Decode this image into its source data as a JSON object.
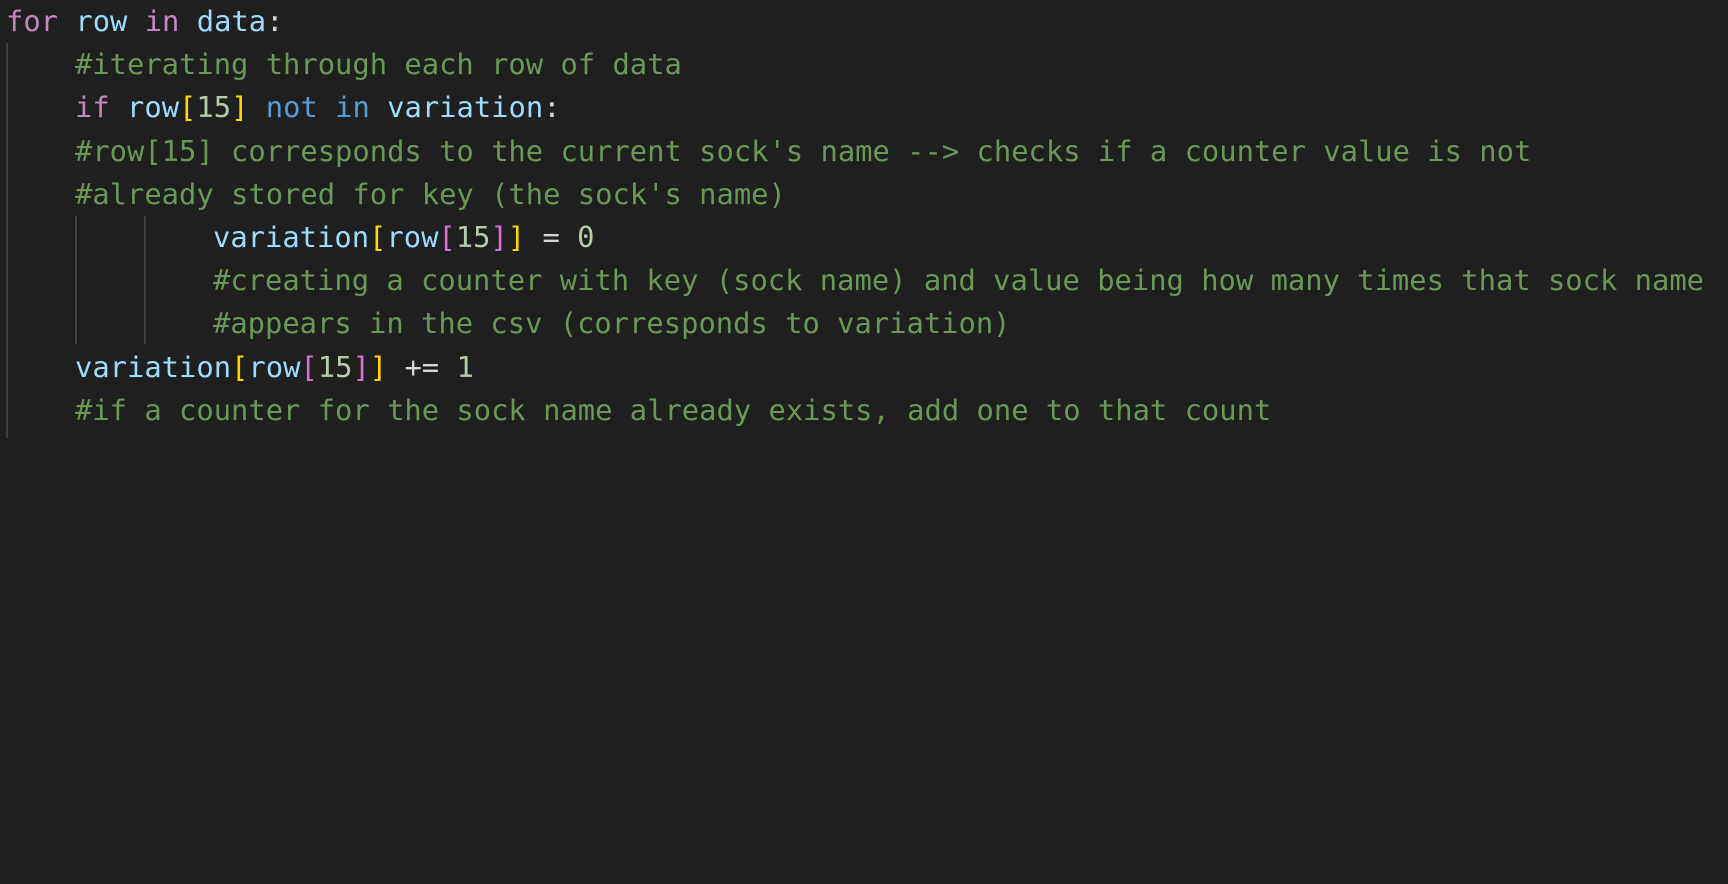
{
  "editor": {
    "theme": {
      "background": "#1f1f1f",
      "keyword_control": "#c586c0",
      "keyword_operator": "#569cd6",
      "variable": "#9cdcfe",
      "number": "#b5cea8",
      "comment": "#6a9955",
      "bracket_level_1": "#ffd700",
      "bracket_level_2": "#da70d6",
      "text": "#d4d4d4"
    },
    "lines": [
      {
        "tokens": [
          "for",
          " ",
          "row",
          " ",
          "in",
          " ",
          "data",
          ":"
        ]
      },
      {
        "comment": "#iterating through each row of data"
      },
      {
        "tokens": [
          "if",
          " ",
          "row",
          "[",
          "15",
          "]",
          " ",
          "not",
          " ",
          "in",
          " ",
          "variation",
          ":"
        ]
      },
      {
        "comment": "#row[15] corresponds to the current sock's name --> checks if a counter value is not"
      },
      {
        "comment": "#already stored for key (the sock's name)"
      },
      {
        "tokens": [
          "variation",
          "[",
          "row",
          "[",
          "15",
          "]",
          "]",
          " = ",
          "0"
        ]
      },
      {
        "comment": "#creating a counter with key (sock name) and value being how many times that sock name"
      },
      {
        "comment": "#appears in the csv (corresponds to variation)"
      },
      {
        "tokens": [
          "variation",
          "[",
          "row",
          "[",
          "15",
          "]",
          "]",
          " += ",
          "1"
        ]
      },
      {
        "comment": "#if a counter for the sock name already exists, add one to that count"
      }
    ]
  }
}
